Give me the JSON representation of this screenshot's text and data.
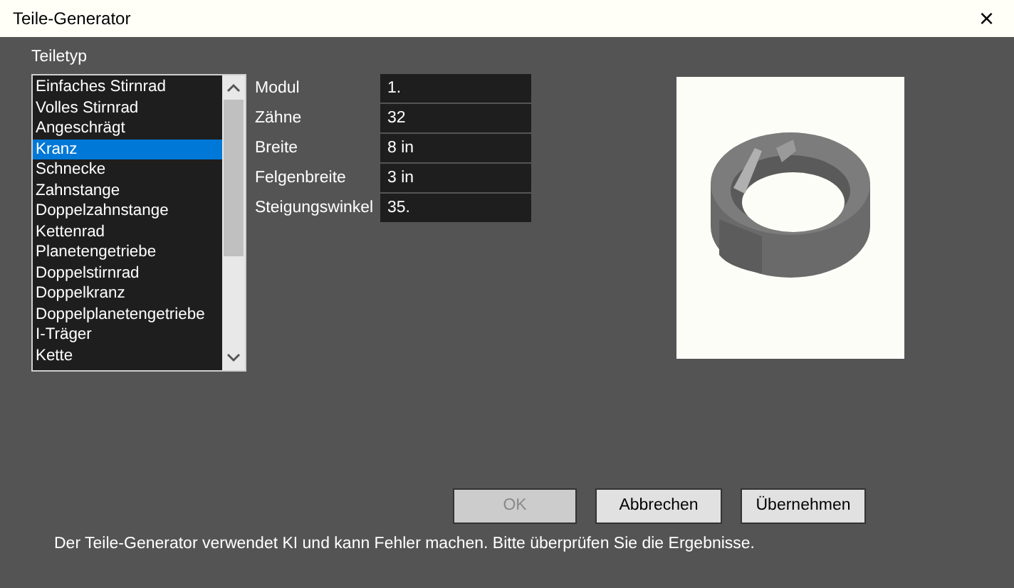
{
  "window": {
    "title": "Teile-Generator",
    "close": "×"
  },
  "part_type": {
    "label": "Teiletyp",
    "items": [
      {
        "label": "Einfaches Stirnrad",
        "selected": false
      },
      {
        "label": "Volles Stirnrad",
        "selected": false
      },
      {
        "label": "Angeschrägt",
        "selected": false
      },
      {
        "label": "Kranz",
        "selected": true
      },
      {
        "label": "Schnecke",
        "selected": false
      },
      {
        "label": "Zahnstange",
        "selected": false
      },
      {
        "label": "Doppelzahnstange",
        "selected": false
      },
      {
        "label": "Kettenrad",
        "selected": false
      },
      {
        "label": "Planetengetriebe",
        "selected": false
      },
      {
        "label": "Doppelstirnrad",
        "selected": false
      },
      {
        "label": "Doppelkranz",
        "selected": false
      },
      {
        "label": "Doppelplanetengetriebe",
        "selected": false
      },
      {
        "label": "I-Träger",
        "selected": false
      },
      {
        "label": "Kette",
        "selected": false
      }
    ]
  },
  "parameters": [
    {
      "label": "Modul",
      "value": "1."
    },
    {
      "label": "Zähne",
      "value": "32"
    },
    {
      "label": "Breite",
      "value": "8 in"
    },
    {
      "label": "Felgenbreite",
      "value": "3 in"
    },
    {
      "label": "Steigungswinkel",
      "value": "35."
    }
  ],
  "buttons": [
    {
      "label": "OK",
      "disabled": true
    },
    {
      "label": "Abbrechen",
      "disabled": false
    },
    {
      "label": "Übernehmen",
      "disabled": false
    }
  ],
  "footer": "Der Teile-Generator verwendet KI und kann Fehler machen. Bitte überprüfen Sie die Ergebnisse."
}
